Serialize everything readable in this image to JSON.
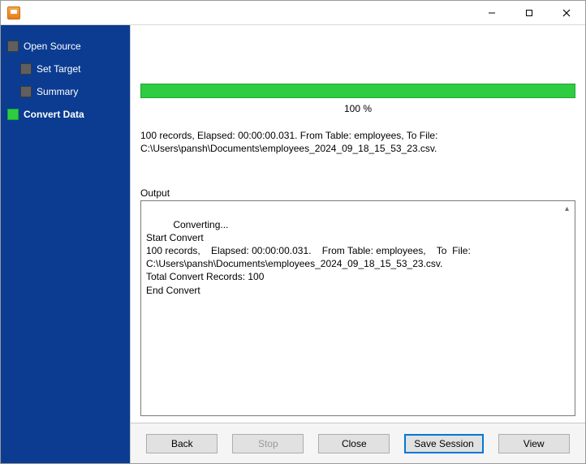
{
  "window": {
    "title": ""
  },
  "sidebar": {
    "items": [
      {
        "label": "Open Source",
        "indent": 0
      },
      {
        "label": "Set Target",
        "indent": 1
      },
      {
        "label": "Summary",
        "indent": 1
      },
      {
        "label": "Convert Data",
        "indent": 0
      }
    ],
    "active_index": 3
  },
  "progress": {
    "percent_text": "100 %",
    "percent_value": 100
  },
  "status": {
    "line1": "100 records,    Elapsed: 00:00:00.031.    From Table: employees,    To  File:",
    "line2": "C:\\Users\\pansh\\Documents\\employees_2024_09_18_15_53_23.csv."
  },
  "output": {
    "label": "Output",
    "text": "Converting...\nStart Convert\n100 records,    Elapsed: 00:00:00.031.    From Table: employees,    To  File: C:\\Users\\pansh\\Documents\\employees_2024_09_18_15_53_23.csv.\nTotal Convert Records: 100\nEnd Convert"
  },
  "buttons": {
    "back": "Back",
    "stop": "Stop",
    "close": "Close",
    "save_session": "Save Session",
    "view": "View"
  }
}
